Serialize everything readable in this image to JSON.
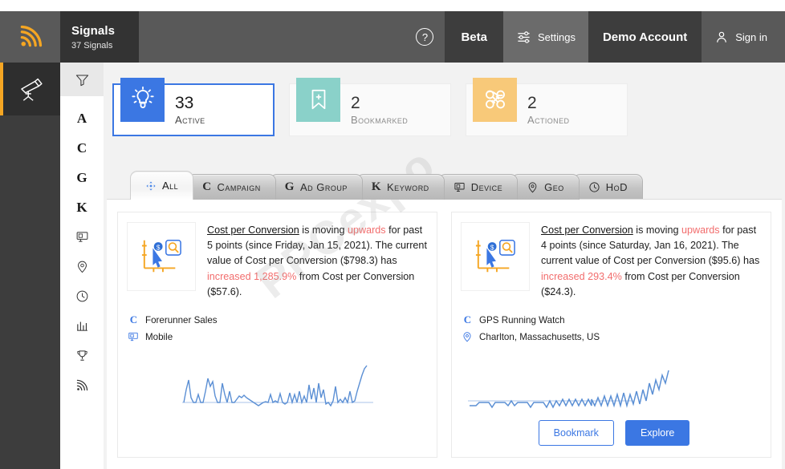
{
  "header": {
    "logo_icon": "signal-icon",
    "title": "Signals",
    "subtitle": "37 Signals",
    "help_label": "?",
    "beta_label": "Beta",
    "settings_label": "Settings",
    "account_label": "Demo Account",
    "signin_label": "Sign in",
    "accent_color": "#f5a623",
    "bar_color": "#595959",
    "dark_color": "#333333"
  },
  "rail_dark": {
    "items": [
      {
        "name": "telescope-icon",
        "active": true
      }
    ]
  },
  "rail_icons": {
    "filter_label": "filter-icon",
    "items": [
      {
        "label": "A",
        "name": "account-letter-icon"
      },
      {
        "label": "C",
        "name": "campaign-letter-icon"
      },
      {
        "label": "G",
        "name": "adgroup-letter-icon"
      },
      {
        "label": "K",
        "name": "keyword-letter-icon"
      },
      {
        "label": "",
        "name": "device-icon"
      },
      {
        "label": "",
        "name": "geo-pin-icon"
      },
      {
        "label": "",
        "name": "clock-icon"
      },
      {
        "label": "",
        "name": "bar-chart-icon"
      },
      {
        "label": "",
        "name": "trophy-icon"
      },
      {
        "label": "",
        "name": "signal-icon"
      }
    ]
  },
  "stats": [
    {
      "count": "33",
      "label": "Active",
      "icon": "lightbulb-icon",
      "color": "#3b77e3",
      "selected": true
    },
    {
      "count": "2",
      "label": "Bookmarked",
      "icon": "bookmark-icon",
      "color": "#8ad1c9",
      "selected": false
    },
    {
      "count": "2",
      "label": "Actioned",
      "icon": "actioned-icon",
      "color": "#f8c979",
      "selected": false
    }
  ],
  "tabs": [
    {
      "label": "All",
      "letter": "",
      "icon": "move-arrows-icon",
      "active": true
    },
    {
      "label": "Campaign",
      "letter": "C",
      "icon": "",
      "active": false
    },
    {
      "label": "Ad Group",
      "letter": "G",
      "icon": "",
      "active": false
    },
    {
      "label": "Keyword",
      "letter": "K",
      "icon": "",
      "active": false
    },
    {
      "label": "Device",
      "letter": "",
      "icon": "device-icon",
      "active": false
    },
    {
      "label": "Geo",
      "letter": "",
      "icon": "geo-pin-icon",
      "active": false
    },
    {
      "label": "HoD",
      "letter": "",
      "icon": "clock-icon",
      "active": false
    }
  ],
  "cards": [
    {
      "icon": "cost-signal-icon",
      "metric": "Cost per Conversion",
      "text_1": " is moving ",
      "direction": "upwards",
      "text_2": " for past 5 points (since Friday, Jan 15, 2021). The current value of Cost per Conversion ($798.3) has ",
      "change": "increased 1,285.9%",
      "text_3": " from Cost per Conversion ($57.6).",
      "meta": [
        {
          "icon": "campaign-letter-icon",
          "letter": "C",
          "label": "Forerunner Sales"
        },
        {
          "icon": "device-icon",
          "letter": "",
          "label": "Mobile"
        }
      ],
      "sparkline": "spiky-rising",
      "show_actions": false,
      "bookmark_label": "Bookmark",
      "explore_label": "Explore"
    },
    {
      "icon": "cost-signal-icon",
      "metric": "Cost per Conversion",
      "text_1": " is moving ",
      "direction": "upwards",
      "text_2": " for past 4 points (since Saturday, Jan 16, 2021). The current value of Cost per Conversion ($95.6) has ",
      "change": "increased 293.4%",
      "text_3": " from Cost per Conversion ($24.3).",
      "meta": [
        {
          "icon": "campaign-letter-icon",
          "letter": "C",
          "label": "GPS Running Watch"
        },
        {
          "icon": "geo-pin-icon",
          "letter": "",
          "label": "Charlton, Massachusetts, US"
        }
      ],
      "sparkline": "oscillating-rising",
      "show_actions": true,
      "bookmark_label": "Bookmark",
      "explore_label": "Explore"
    }
  ],
  "watermark": {
    "text": "PPCexpo"
  },
  "colors": {
    "blue": "#3b77e3",
    "highlight": "#f26d6d",
    "orange": "#f5a623"
  }
}
